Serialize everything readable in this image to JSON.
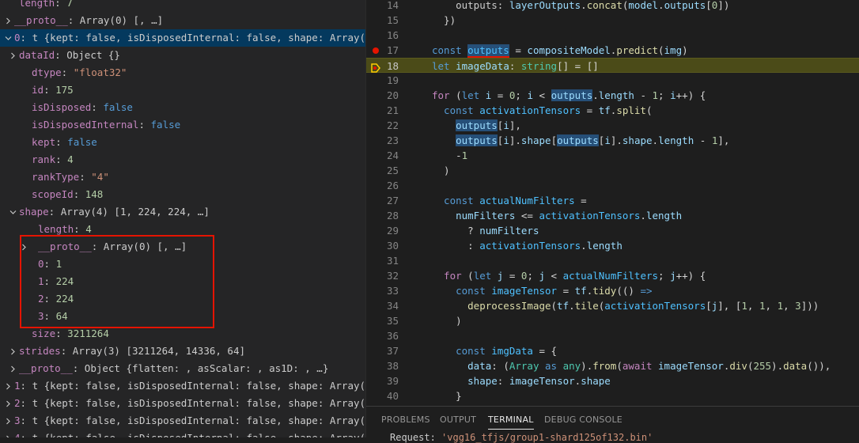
{
  "variables": {
    "rows": [
      {
        "indent": 24,
        "chev": "none",
        "name": "length",
        "sep": ": ",
        "value": "7",
        "vclass": "num"
      },
      {
        "indent": 18,
        "chev": "right",
        "name": "__proto__",
        "sep": ": ",
        "value": "Array(0) [, …]",
        "vclass": "plain"
      },
      {
        "indent": 2,
        "chev": "down",
        "name": "0",
        "sep": ": ",
        "value": "t {kept: false, isDisposedInternal: false, shape: Array(…",
        "vclass": "plain",
        "selected": true
      },
      {
        "indent": 24,
        "chev": "right",
        "name": "dataId",
        "sep": ": ",
        "value": "Object {}",
        "vclass": "plain"
      },
      {
        "indent": 40,
        "chev": "none",
        "name": "dtype",
        "sep": ": ",
        "value": "\"float32\"",
        "vclass": "str"
      },
      {
        "indent": 40,
        "chev": "none",
        "name": "id",
        "sep": ": ",
        "value": "175",
        "vclass": "num"
      },
      {
        "indent": 40,
        "chev": "none",
        "name": "isDisposed",
        "sep": ": ",
        "value": "false",
        "vclass": "bool"
      },
      {
        "indent": 40,
        "chev": "none",
        "name": "isDisposedInternal",
        "sep": ": ",
        "value": "false",
        "vclass": "bool"
      },
      {
        "indent": 40,
        "chev": "none",
        "name": "kept",
        "sep": ": ",
        "value": "false",
        "vclass": "bool"
      },
      {
        "indent": 40,
        "chev": "none",
        "name": "rank",
        "sep": ": ",
        "value": "4",
        "vclass": "num"
      },
      {
        "indent": 40,
        "chev": "none",
        "name": "rankType",
        "sep": ": ",
        "value": "\"4\"",
        "vclass": "str"
      },
      {
        "indent": 40,
        "chev": "none",
        "name": "scopeId",
        "sep": ": ",
        "value": "148",
        "vclass": "num"
      },
      {
        "indent": 24,
        "chev": "down",
        "name": "shape",
        "sep": ": ",
        "value": "Array(4) [1, 224, 224, …]",
        "vclass": "plain"
      },
      {
        "indent": 48,
        "chev": "none",
        "name": "length",
        "sep": ": ",
        "value": "4",
        "vclass": "num"
      },
      {
        "indent": 48,
        "chev": "right",
        "name": "__proto__",
        "sep": ": ",
        "value": "Array(0) [, …]",
        "vclass": "plain"
      },
      {
        "indent": 48,
        "chev": "none",
        "name": "0",
        "sep": ": ",
        "value": "1",
        "vclass": "num"
      },
      {
        "indent": 48,
        "chev": "none",
        "name": "1",
        "sep": ": ",
        "value": "224",
        "vclass": "num"
      },
      {
        "indent": 48,
        "chev": "none",
        "name": "2",
        "sep": ": ",
        "value": "224",
        "vclass": "num"
      },
      {
        "indent": 48,
        "chev": "none",
        "name": "3",
        "sep": ": ",
        "value": "64",
        "vclass": "num"
      },
      {
        "indent": 40,
        "chev": "none",
        "name": "size",
        "sep": ": ",
        "value": "3211264",
        "vclass": "num"
      },
      {
        "indent": 24,
        "chev": "right",
        "name": "strides",
        "sep": ": ",
        "value": "Array(3) [3211264, 14336, 64]",
        "vclass": "plain"
      },
      {
        "indent": 24,
        "chev": "right",
        "name": "__proto__",
        "sep": ": ",
        "value": "Object {flatten: , asScalar: , as1D: , …}",
        "vclass": "plain"
      },
      {
        "indent": 2,
        "chev": "right",
        "name": "1",
        "sep": ": ",
        "value": "t {kept: false, isDisposedInternal: false, shape: Array(…",
        "vclass": "plain"
      },
      {
        "indent": 2,
        "chev": "right",
        "name": "2",
        "sep": ": ",
        "value": "t {kept: false, isDisposedInternal: false, shape: Array(…",
        "vclass": "plain"
      },
      {
        "indent": 2,
        "chev": "right",
        "name": "3",
        "sep": ": ",
        "value": "t {kept: false, isDisposedInternal: false, shape: Array(…",
        "vclass": "plain"
      },
      {
        "indent": 2,
        "chev": "right",
        "name": "4",
        "sep": ": ",
        "value": "t {kept: false, isDisposedInternal: false, shape: Array(…",
        "vclass": "plain"
      }
    ]
  },
  "editor": {
    "lines": [
      {
        "n": "14",
        "html": [
          [
            "    ",
            ""
          ],
          [
            "outputs",
            ""
          ],
          [
            ": ",
            "pn"
          ],
          [
            "layerOutputs",
            "vr"
          ],
          [
            ".",
            "pn"
          ],
          [
            "concat",
            "fn"
          ],
          [
            "(",
            "pn"
          ],
          [
            "model",
            "vr"
          ],
          [
            ".",
            "pn"
          ],
          [
            "outputs",
            "vr"
          ],
          [
            "[",
            "pn"
          ],
          [
            "0",
            "nm"
          ],
          [
            "])",
            "pn"
          ]
        ]
      },
      {
        "n": "15",
        "html": [
          [
            "  })",
            "pn"
          ]
        ]
      },
      {
        "n": "16",
        "html": []
      },
      {
        "n": "17",
        "bp": true,
        "html": [
          [
            "const ",
            "kw"
          ],
          [
            "outputs",
            "ct hl red-underline"
          ],
          [
            " = ",
            "pn"
          ],
          [
            "compositeModel",
            "vr"
          ],
          [
            ".",
            "pn"
          ],
          [
            "predict",
            "fn"
          ],
          [
            "(",
            "pn"
          ],
          [
            "img",
            "vr"
          ],
          [
            ")",
            "pn"
          ]
        ]
      },
      {
        "n": "18",
        "current": true,
        "html": [
          [
            "let ",
            "kw"
          ],
          [
            "imageData",
            "vr"
          ],
          [
            ": ",
            "pn"
          ],
          [
            "string",
            "ty"
          ],
          [
            "[] = []",
            "pn"
          ]
        ]
      },
      {
        "n": "19",
        "html": []
      },
      {
        "n": "20",
        "html": [
          [
            "for ",
            "kw2"
          ],
          [
            "(",
            "pn"
          ],
          [
            "let ",
            "kw"
          ],
          [
            "i",
            "vr"
          ],
          [
            " = ",
            "pn"
          ],
          [
            "0",
            "nm"
          ],
          [
            "; ",
            "pn"
          ],
          [
            "i",
            "vr"
          ],
          [
            " < ",
            "pn"
          ],
          [
            "outputs",
            "vr hl"
          ],
          [
            ".",
            "pn"
          ],
          [
            "length",
            "vr"
          ],
          [
            " - ",
            "pn"
          ],
          [
            "1",
            "nm"
          ],
          [
            "; ",
            "pn"
          ],
          [
            "i",
            "vr"
          ],
          [
            "++) {",
            "pn"
          ]
        ]
      },
      {
        "n": "21",
        "html": [
          [
            "  const ",
            "kw"
          ],
          [
            "activationTensors",
            "ct"
          ],
          [
            " = ",
            "pn"
          ],
          [
            "tf",
            "vr"
          ],
          [
            ".",
            "pn"
          ],
          [
            "split",
            "fn"
          ],
          [
            "(",
            "pn"
          ]
        ]
      },
      {
        "n": "22",
        "html": [
          [
            "    ",
            ""
          ],
          [
            "outputs",
            "vr hl"
          ],
          [
            "[",
            "pn"
          ],
          [
            "i",
            "vr"
          ],
          [
            "],",
            "pn"
          ]
        ]
      },
      {
        "n": "23",
        "html": [
          [
            "    ",
            ""
          ],
          [
            "outputs",
            "vr hl"
          ],
          [
            "[",
            "pn"
          ],
          [
            "i",
            "vr"
          ],
          [
            "].",
            "pn"
          ],
          [
            "shape",
            "vr"
          ],
          [
            "[",
            "pn"
          ],
          [
            "outputs",
            "vr hl"
          ],
          [
            "[",
            "pn"
          ],
          [
            "i",
            "vr"
          ],
          [
            "].",
            "pn"
          ],
          [
            "shape",
            "vr"
          ],
          [
            ".",
            "pn"
          ],
          [
            "length",
            "vr"
          ],
          [
            " - ",
            "pn"
          ],
          [
            "1",
            "nm"
          ],
          [
            "],",
            "pn"
          ]
        ]
      },
      {
        "n": "24",
        "html": [
          [
            "    -",
            "pn"
          ],
          [
            "1",
            "nm"
          ]
        ]
      },
      {
        "n": "25",
        "html": [
          [
            "  )",
            "pn"
          ]
        ]
      },
      {
        "n": "26",
        "html": []
      },
      {
        "n": "27",
        "html": [
          [
            "  const ",
            "kw"
          ],
          [
            "actualNumFilters",
            "ct"
          ],
          [
            " =",
            "pn"
          ]
        ]
      },
      {
        "n": "28",
        "html": [
          [
            "    ",
            ""
          ],
          [
            "numFilters",
            "vr"
          ],
          [
            " <= ",
            "pn"
          ],
          [
            "activationTensors",
            "ct"
          ],
          [
            ".",
            "pn"
          ],
          [
            "length",
            "vr"
          ]
        ]
      },
      {
        "n": "29",
        "html": [
          [
            "      ? ",
            "pn"
          ],
          [
            "numFilters",
            "vr"
          ]
        ]
      },
      {
        "n": "30",
        "html": [
          [
            "      : ",
            "pn"
          ],
          [
            "activationTensors",
            "ct"
          ],
          [
            ".",
            "pn"
          ],
          [
            "length",
            "vr"
          ]
        ]
      },
      {
        "n": "31",
        "html": []
      },
      {
        "n": "32",
        "html": [
          [
            "  for ",
            "kw2"
          ],
          [
            "(",
            "pn"
          ],
          [
            "let ",
            "kw"
          ],
          [
            "j",
            "vr"
          ],
          [
            " = ",
            "pn"
          ],
          [
            "0",
            "nm"
          ],
          [
            "; ",
            "pn"
          ],
          [
            "j",
            "vr"
          ],
          [
            " < ",
            "pn"
          ],
          [
            "actualNumFilters",
            "ct"
          ],
          [
            "; ",
            "pn"
          ],
          [
            "j",
            "vr"
          ],
          [
            "++) {",
            "pn"
          ]
        ]
      },
      {
        "n": "33",
        "html": [
          [
            "    const ",
            "kw"
          ],
          [
            "imageTensor",
            "ct"
          ],
          [
            " = ",
            "pn"
          ],
          [
            "tf",
            "vr"
          ],
          [
            ".",
            "pn"
          ],
          [
            "tidy",
            "fn"
          ],
          [
            "(() ",
            "pn"
          ],
          [
            "=>",
            "kw"
          ]
        ]
      },
      {
        "n": "34",
        "html": [
          [
            "      ",
            ""
          ],
          [
            "deprocessImage",
            "fn"
          ],
          [
            "(",
            "pn"
          ],
          [
            "tf",
            "vr"
          ],
          [
            ".",
            "pn"
          ],
          [
            "tile",
            "fn"
          ],
          [
            "(",
            "pn"
          ],
          [
            "activationTensors",
            "ct"
          ],
          [
            "[",
            "pn"
          ],
          [
            "j",
            "vr"
          ],
          [
            "], [",
            "pn"
          ],
          [
            "1",
            "nm"
          ],
          [
            ", ",
            "pn"
          ],
          [
            "1",
            "nm"
          ],
          [
            ", ",
            "pn"
          ],
          [
            "1",
            "nm"
          ],
          [
            ", ",
            "pn"
          ],
          [
            "3",
            "nm"
          ],
          [
            "]))",
            "pn"
          ]
        ]
      },
      {
        "n": "35",
        "html": [
          [
            "    )",
            "pn"
          ]
        ]
      },
      {
        "n": "36",
        "html": []
      },
      {
        "n": "37",
        "html": [
          [
            "    const ",
            "kw"
          ],
          [
            "imgData",
            "ct"
          ],
          [
            " = {",
            "pn"
          ]
        ]
      },
      {
        "n": "38",
        "html": [
          [
            "      ",
            ""
          ],
          [
            "data",
            "vr"
          ],
          [
            ": (",
            "pn"
          ],
          [
            "Array",
            "ty"
          ],
          [
            " as ",
            "kw"
          ],
          [
            "any",
            "ty"
          ],
          [
            ").",
            "pn"
          ],
          [
            "from",
            "fn"
          ],
          [
            "(",
            "pn"
          ],
          [
            "await ",
            "kw2"
          ],
          [
            "imageTensor",
            "vr"
          ],
          [
            ".",
            "pn"
          ],
          [
            "div",
            "fn"
          ],
          [
            "(",
            "pn"
          ],
          [
            "255",
            "nm"
          ],
          [
            ").",
            "pn"
          ],
          [
            "data",
            "fn"
          ],
          [
            "()),",
            "pn"
          ]
        ]
      },
      {
        "n": "39",
        "html": [
          [
            "      ",
            ""
          ],
          [
            "shape",
            "vr"
          ],
          [
            ": ",
            "pn"
          ],
          [
            "imageTensor",
            "vr"
          ],
          [
            ".",
            "pn"
          ],
          [
            "shape",
            "vr"
          ]
        ]
      },
      {
        "n": "40",
        "html": [
          [
            "    }",
            "pn"
          ]
        ]
      }
    ]
  },
  "panel": {
    "tabs": [
      {
        "label": "PROBLEMS",
        "active": false
      },
      {
        "label": "OUTPUT",
        "active": false
      },
      {
        "label": "TERMINAL",
        "active": true
      },
      {
        "label": "DEBUG CONSOLE",
        "active": false
      }
    ],
    "terminal_prefix": "Request: ",
    "terminal_string": "'vgg16_tfjs/group1-shard125of132.bin'"
  },
  "colors": {
    "highlight_box": "#e51400",
    "breakpoint": "#e51400",
    "current_line": "#4b4b18",
    "selected_row": "#04395e"
  }
}
